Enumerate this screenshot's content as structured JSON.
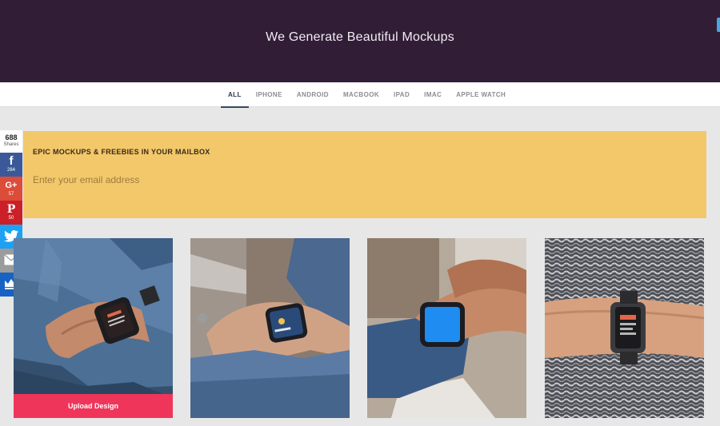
{
  "hero": {
    "title": "We Generate Beautiful Mockups"
  },
  "nav": {
    "tabs": [
      {
        "label": "ALL",
        "active": true
      },
      {
        "label": "IPHONE",
        "active": false
      },
      {
        "label": "ANDROID",
        "active": false
      },
      {
        "label": "MACBOOK",
        "active": false
      },
      {
        "label": "IPAD",
        "active": false
      },
      {
        "label": "IMAC",
        "active": false
      },
      {
        "label": "APPLE WATCH",
        "active": false
      }
    ]
  },
  "share": {
    "total": "688",
    "total_label": "Shares",
    "facebook": {
      "icon": "f",
      "count": "284"
    },
    "googleplus": {
      "icon": "G+",
      "count": "57"
    },
    "pinterest": {
      "icon": "P",
      "count": "50"
    },
    "twitter": {
      "icon": "twitter-icon"
    },
    "email": {
      "icon": "email-icon"
    },
    "sumo": {
      "icon": "crown-icon"
    }
  },
  "newsletter": {
    "title": "EPIC MOCKUPS & FREEBIES IN YOUR MAILBOX",
    "placeholder": "Enter your email address",
    "value": ""
  },
  "cards": [
    {
      "upload_label": "Upload Design"
    }
  ],
  "colors": {
    "hero_bg": "#321d37",
    "newsletter_bg": "#f2c86a",
    "upload_button": "#f0355a",
    "facebook": "#3b5998",
    "googleplus": "#dd4b39",
    "pinterest": "#cb2027",
    "twitter": "#1da1f2",
    "email": "#9b9b9b",
    "sumo": "#1763c4"
  }
}
